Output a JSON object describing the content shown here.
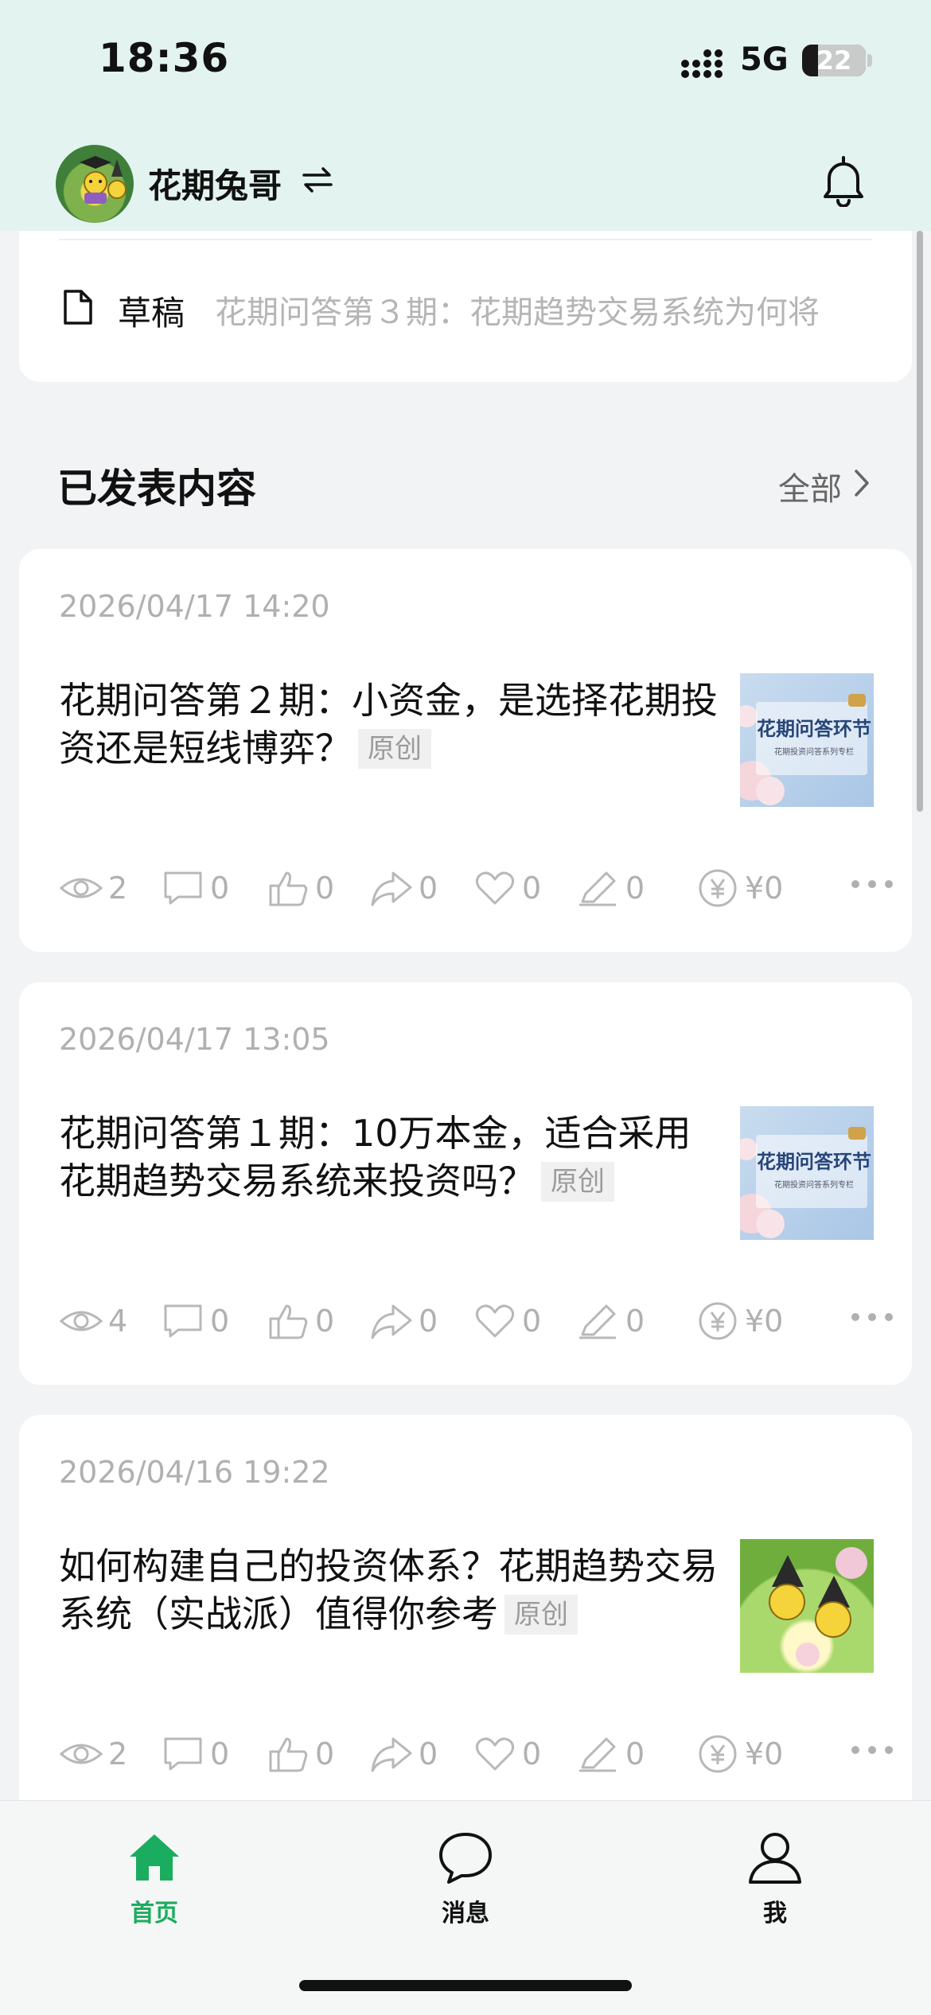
{
  "status_bar": {
    "time": "18:36",
    "network": "5G",
    "battery": "22"
  },
  "header": {
    "username": "花期兔哥",
    "switch_glyph": "⇋"
  },
  "draft": {
    "label": "草稿",
    "title": "花期问答第３期：花期趋势交易系统为何将"
  },
  "section": {
    "title": "已发表内容",
    "all_label": "全部"
  },
  "posts": [
    {
      "date": "2026/04/17 14:20",
      "title": "花期问答第２期：小资金，是选择花期投资还是短线博弈？",
      "tag": "原创",
      "thumb_text": "花期问答环节",
      "thumb_sub": "花期投资问答系列专栏",
      "stats": {
        "views": "2",
        "comments": "0",
        "likes": "0",
        "shares": "0",
        "favorites": "0",
        "edits": "0",
        "rewards": "¥0"
      }
    },
    {
      "date": "2026/04/17 13:05",
      "title": "花期问答第１期：10万本金，适合采用花期趋势交易系统来投资吗？",
      "tag": "原创",
      "thumb_text": "花期问答环节",
      "thumb_sub": "花期投资问答系列专栏",
      "stats": {
        "views": "4",
        "comments": "0",
        "likes": "0",
        "shares": "0",
        "favorites": "0",
        "edits": "0",
        "rewards": "¥0"
      }
    },
    {
      "date": "2026/04/16 19:22",
      "title": "如何构建自己的投资体系？花期趋势交易系统（实战派）值得你参考",
      "tag": "原创",
      "stats": {
        "views": "2",
        "comments": "0",
        "likes": "0",
        "shares": "0",
        "favorites": "0",
        "edits": "0",
        "rewards": "¥0"
      }
    }
  ],
  "tabbar": {
    "home": "首页",
    "messages": "消息",
    "me": "我",
    "active_color": "#1aad5f"
  }
}
